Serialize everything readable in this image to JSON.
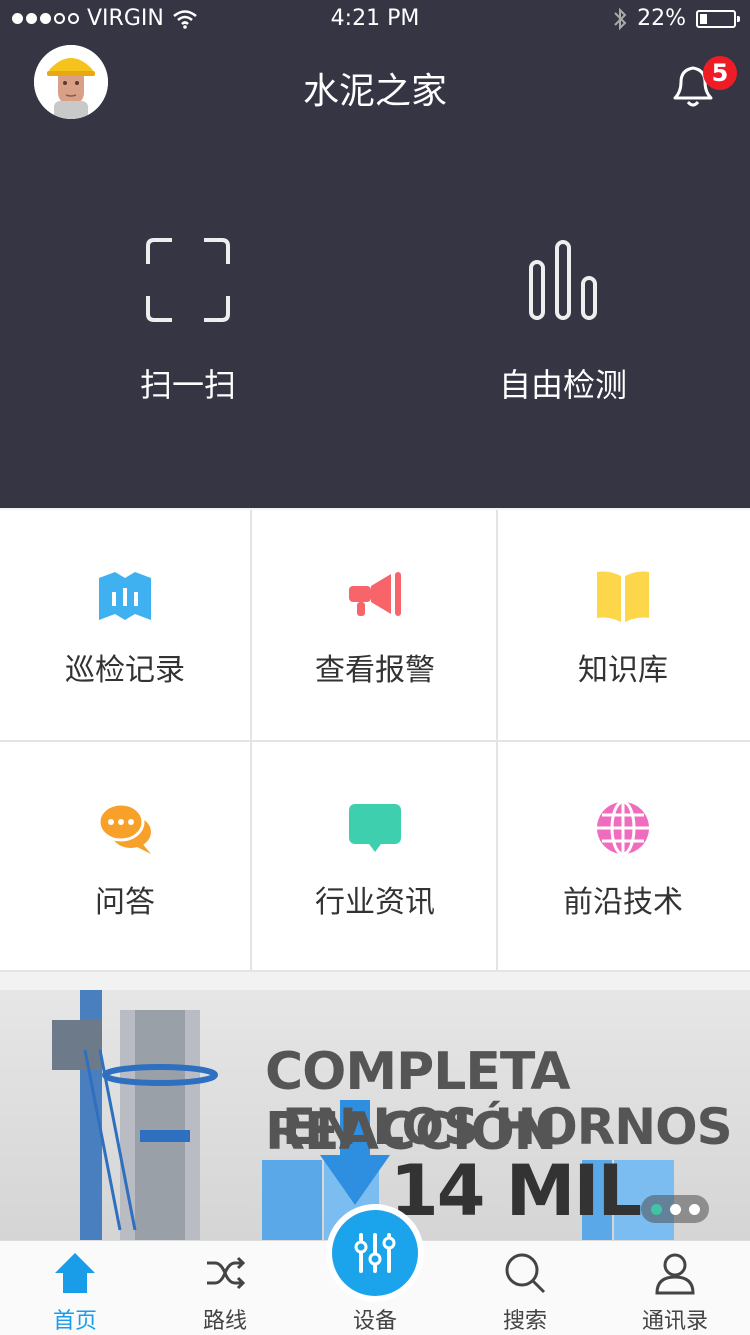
{
  "status_bar": {
    "carrier": "VIRGIN",
    "time": "4:21 PM",
    "battery": "22%",
    "battery_level": 0.22
  },
  "header": {
    "title": "水泥之家",
    "notification_count": "5"
  },
  "quick_actions": [
    {
      "label": "扫一扫",
      "icon": "scan-icon"
    },
    {
      "label": "自由检测",
      "icon": "bar-chart-icon"
    }
  ],
  "grid": [
    {
      "label": "巡检记录",
      "icon": "map-icon",
      "color": "#3fb0f0"
    },
    {
      "label": "查看报警",
      "icon": "megaphone-icon",
      "color": "#f7646a"
    },
    {
      "label": "知识库",
      "icon": "book-icon",
      "color": "#fdd649"
    },
    {
      "label": "问答",
      "icon": "chat-bubbles-icon",
      "color": "#f7a12a"
    },
    {
      "label": "行业资讯",
      "icon": "message-icon",
      "color": "#3ecfaf"
    },
    {
      "label": "前沿技术",
      "icon": "globe-icon",
      "color": "#f06cbe"
    }
  ],
  "banner": {
    "line1": "COMPLETA REACCIÓN",
    "line2": "EN LOS HORNOS",
    "line3": "14 MIL"
  },
  "tabs": [
    {
      "label": "首页",
      "icon": "home-icon"
    },
    {
      "label": "路线",
      "icon": "shuffle-icon"
    },
    {
      "label": "设备",
      "icon": "equalizer-icon"
    },
    {
      "label": "搜索",
      "icon": "search-icon"
    },
    {
      "label": "通讯录",
      "icon": "contacts-icon"
    }
  ],
  "colors": {
    "header_bg": "#363544",
    "accent": "#1a9de8",
    "badge": "#ee1c25"
  }
}
